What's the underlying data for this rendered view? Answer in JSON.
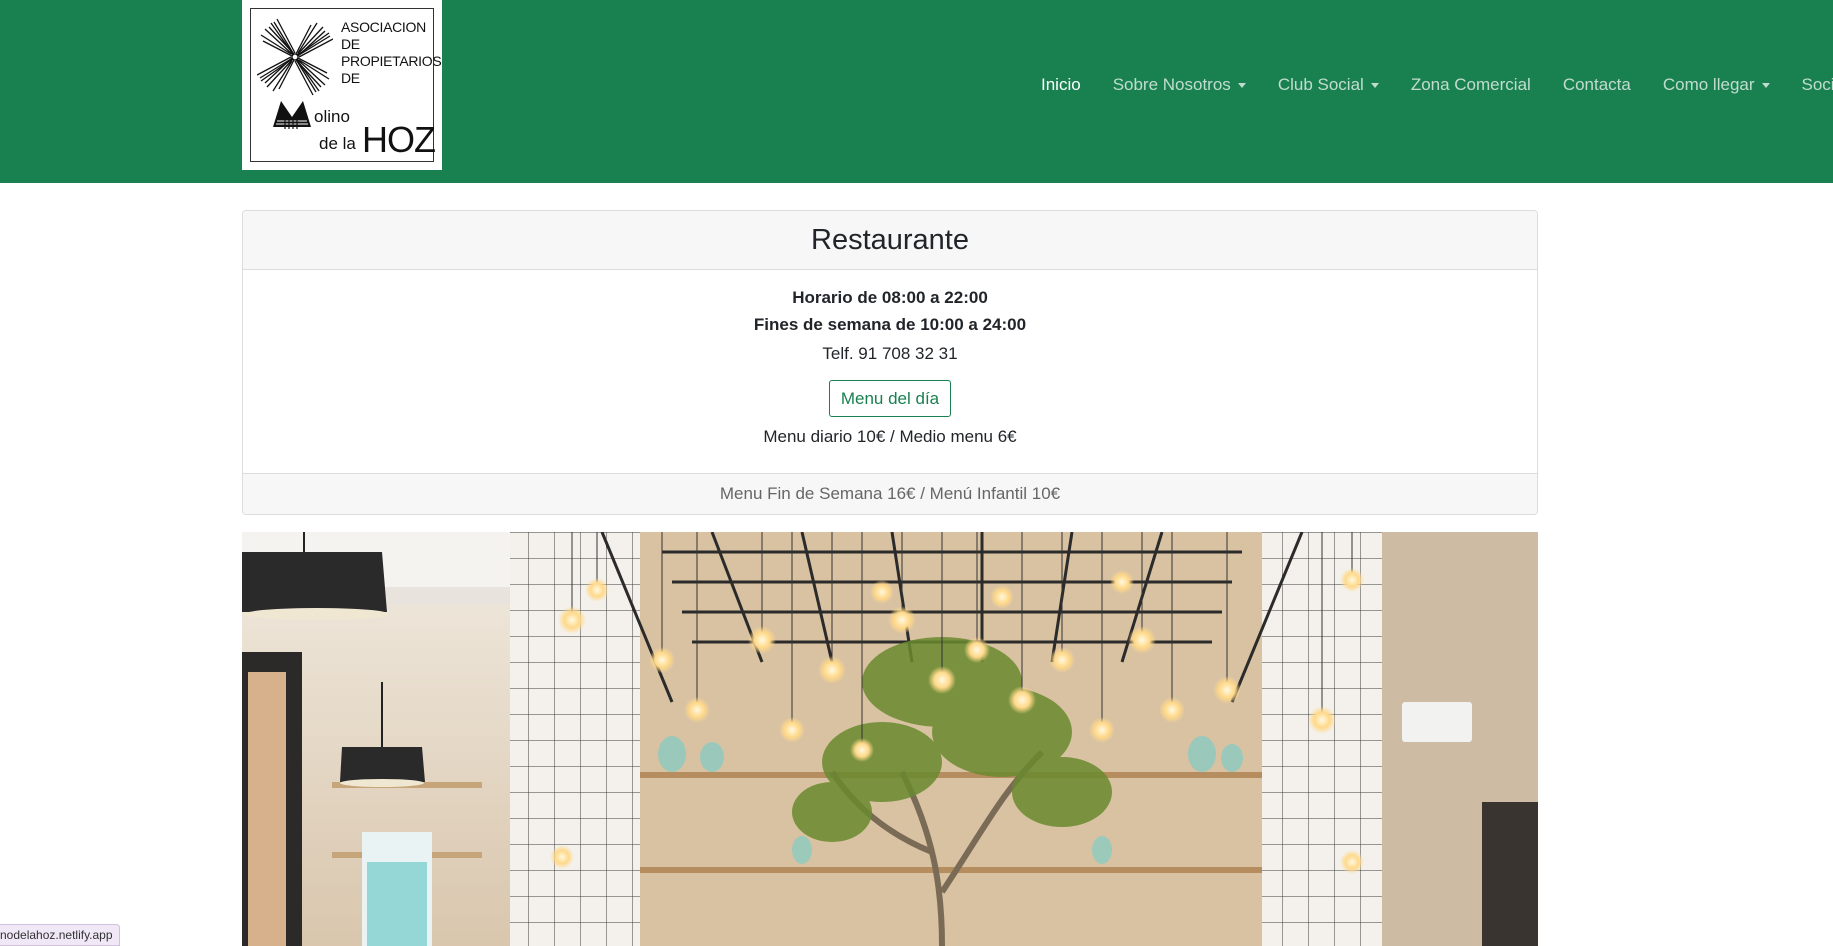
{
  "logo": {
    "line1": "ASOCIACION",
    "line2": "DE",
    "line3": "PROPIETARIOS",
    "line4": "DE",
    "olino": "olino",
    "dela": "de la",
    "hoz": "HOZ"
  },
  "nav": {
    "items": [
      {
        "label": "Inicio",
        "active": true,
        "dropdown": false
      },
      {
        "label": "Sobre Nosotros",
        "active": false,
        "dropdown": true
      },
      {
        "label": "Club Social",
        "active": false,
        "dropdown": true
      },
      {
        "label": "Zona Comercial",
        "active": false,
        "dropdown": false
      },
      {
        "label": "Contacta",
        "active": false,
        "dropdown": false
      },
      {
        "label": "Como llegar",
        "active": false,
        "dropdown": true
      },
      {
        "label": "Socios",
        "active": false,
        "dropdown": false
      }
    ]
  },
  "restaurant": {
    "title": "Restaurante",
    "hours_weekday": "Horario de 08:00 a 22:00",
    "hours_weekend": "Fines de semana de 10:00 a 24:00",
    "phone": "Telf. 91 708 32 31",
    "menu_button": "Menu del día",
    "prices": "Menu diario 10€ / Medio menu 6€",
    "footer": "Menu Fin de Semana 16€ / Menú Infantil 10€"
  },
  "status_bar": {
    "url": "nodelahoz.netlify.app"
  },
  "colors": {
    "navbar": "#198050",
    "accent": "#198050"
  }
}
